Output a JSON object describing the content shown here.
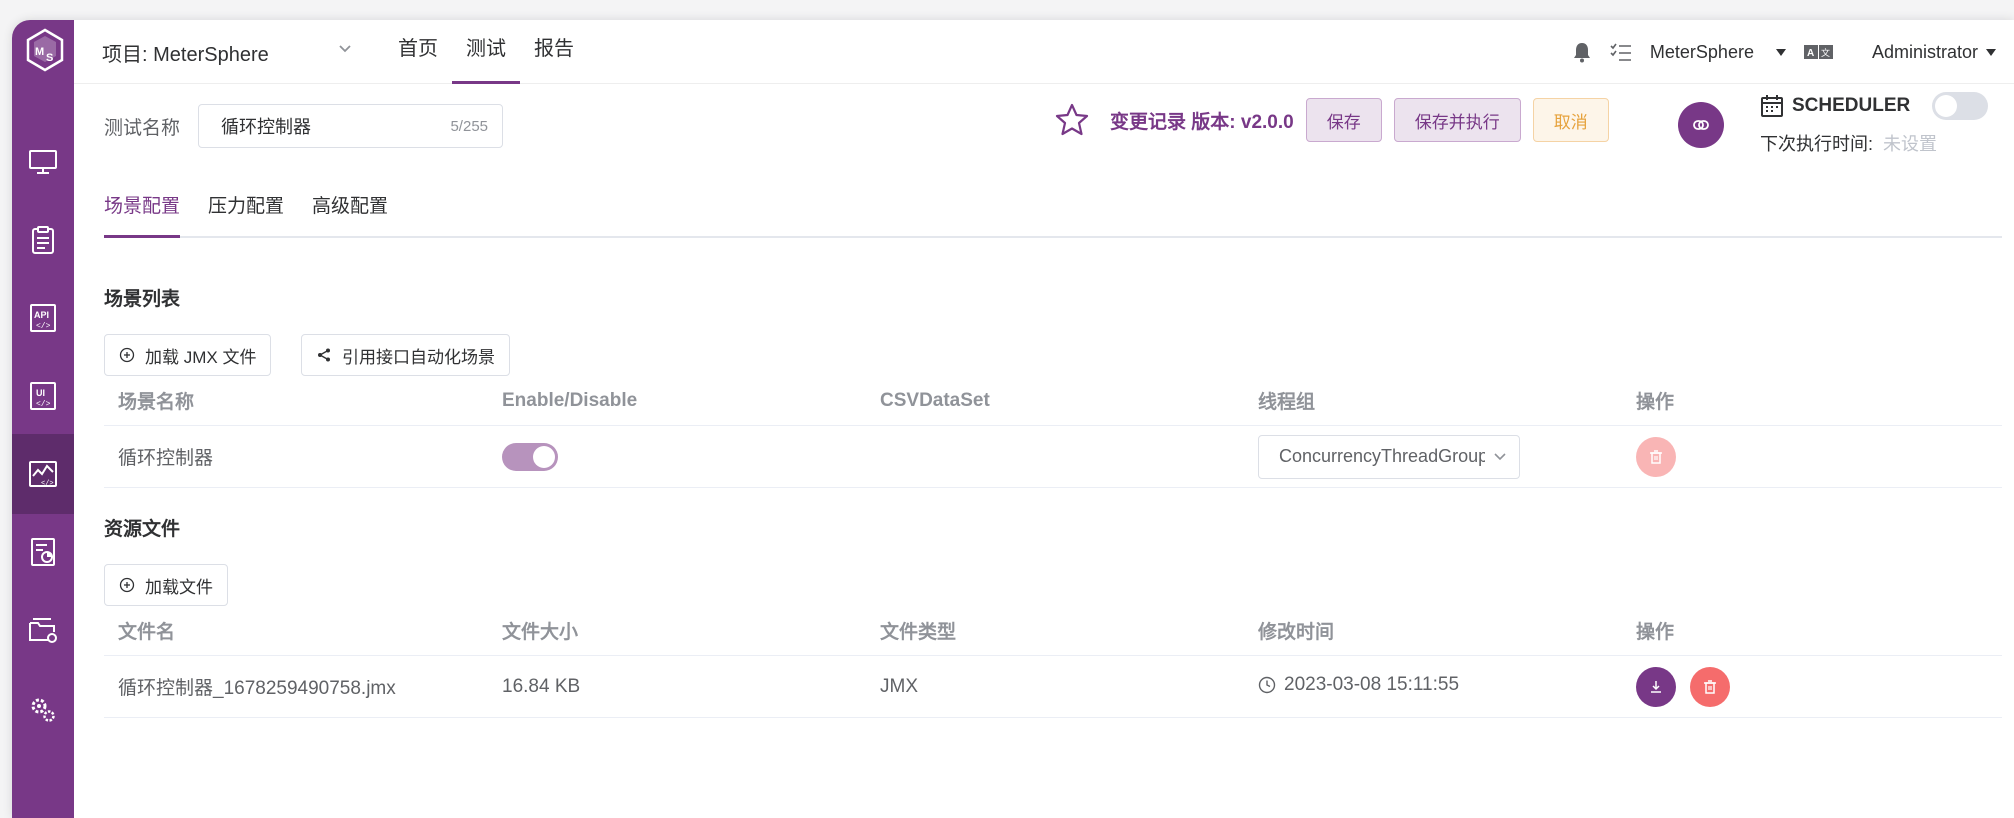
{
  "header": {
    "project_label": "项目: MeterSphere",
    "nav": [
      {
        "label": "首页"
      },
      {
        "label": "测试"
      },
      {
        "label": "报告"
      }
    ],
    "workspace": "MeterSphere",
    "user": "Administrator"
  },
  "test": {
    "name_label": "测试名称",
    "name_value": "循环控制器",
    "name_count": "5/255",
    "version_text": "变更记录 版本: v2.0.0",
    "save_label": "保存",
    "save_run_label": "保存并执行",
    "cancel_label": "取消"
  },
  "scheduler": {
    "title": "SCHEDULER",
    "next_label": "下次执行时间:",
    "next_value": "未设置"
  },
  "tabs": [
    {
      "label": "场景配置"
    },
    {
      "label": "压力配置"
    },
    {
      "label": "高级配置"
    }
  ],
  "scenes": {
    "title": "场景列表",
    "load_jmx_label": "加载 JMX 文件",
    "ref_label": "引用接口自动化场景",
    "columns": [
      "场景名称",
      "Enable/Disable",
      "CSVDataSet",
      "线程组",
      "操作"
    ],
    "rows": [
      {
        "name": "循环控制器",
        "enabled": true,
        "thread_group": "ConcurrencyThreadGroup"
      }
    ]
  },
  "files": {
    "title": "资源文件",
    "load_label": "加载文件",
    "columns": [
      "文件名",
      "文件大小",
      "文件类型",
      "修改时间",
      "操作"
    ],
    "rows": [
      {
        "name": "循环控制器_1678259490758.jmx",
        "size": "16.84 KB",
        "type": "JMX",
        "modified": "2023-03-08 15:11:55"
      }
    ]
  },
  "colors": {
    "primary": "#783887",
    "danger": "#f56c6c",
    "warning": "#e6a23c"
  }
}
